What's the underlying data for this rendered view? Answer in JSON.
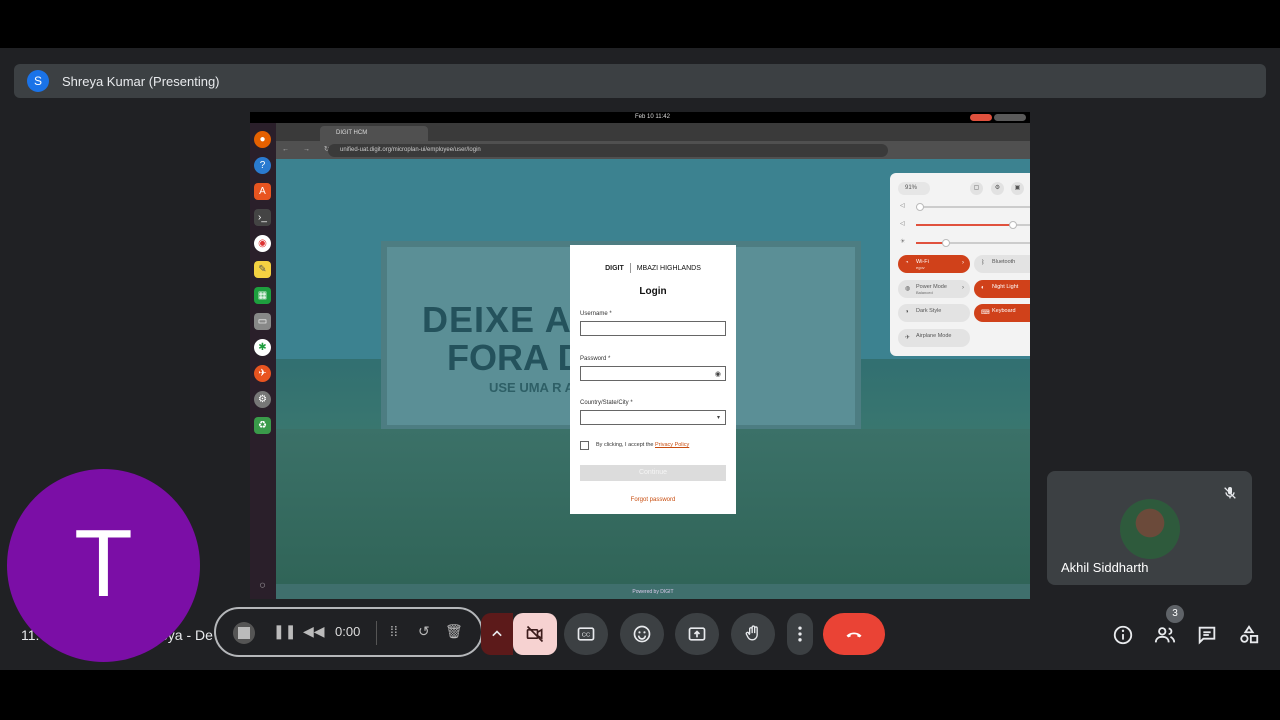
{
  "presenter": {
    "initial": "S",
    "label": "Shreya Kumar (Presenting)"
  },
  "shared_screen": {
    "clock": "Feb 10  11:42",
    "browser_tab": "DIGIT HCM",
    "url": "unified-uat.digit.org/microplan-ui/employee/user/login",
    "billboard": {
      "line1": "DEIXE        ARIA",
      "line2": "FORA          DE.",
      "line3": "USE UMA R                ADA."
    },
    "login": {
      "logo_digit": "DIGIT",
      "logo_org": "MBAZI HIGHLANDS",
      "title": "Login",
      "username_label": "Username *",
      "password_label": "Password *",
      "location_label": "Country/State/City *",
      "accept_text": "By clicking, I accept the",
      "privacy_link": "Privacy Policy",
      "continue_label": "Continue",
      "forgot_label": "Forgot password"
    },
    "powered_by": "Powered by DIGIT",
    "quick_settings": {
      "battery": "91%",
      "wifi_label": "Wi-Fi",
      "wifi_sub": "egov",
      "bluetooth_label": "Bluetooth",
      "power_label": "Power Mode",
      "power_sub": "Balanced",
      "nightlight_label": "Night Light",
      "darkstyle_label": "Dark Style",
      "keyboard_label": "Keyboard",
      "airplane_label": "Airplane Mode",
      "volume_level": 0.76,
      "brightness_level": 0.24
    }
  },
  "participant": {
    "name": "Akhil Siddharth"
  },
  "self_view": {
    "initial": "T"
  },
  "meeting": {
    "time": "11:",
    "name": "eya - De"
  },
  "recorder": {
    "timer": "0:00"
  },
  "people_count": "3",
  "colors": {
    "accent": "#d0411a",
    "hangup": "#ea4335",
    "self_avatar": "#7b0ea6"
  }
}
